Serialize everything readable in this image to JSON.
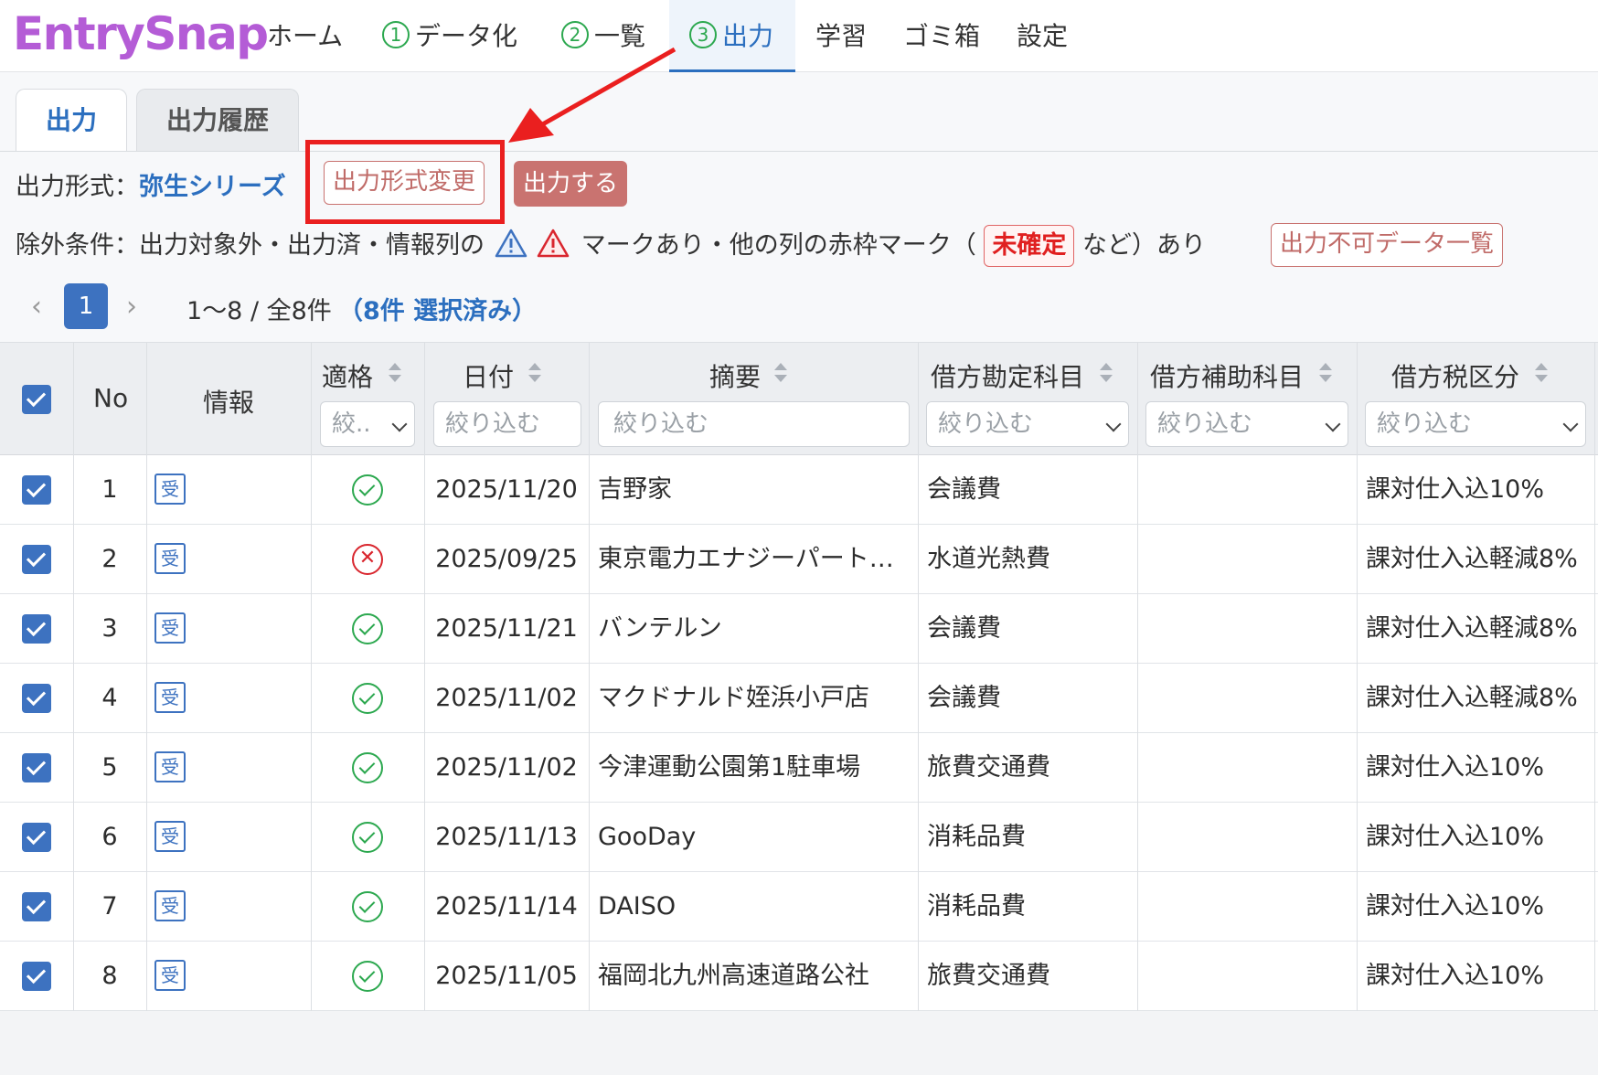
{
  "app": {
    "logo": "EntrySnap"
  },
  "nav": {
    "items": [
      {
        "label": "ホーム",
        "num": ""
      },
      {
        "label": "データ化",
        "num": "1"
      },
      {
        "label": "一覧",
        "num": "2"
      },
      {
        "label": "出力",
        "num": "3"
      },
      {
        "label": "学習",
        "num": ""
      },
      {
        "label": "ゴミ箱",
        "num": ""
      },
      {
        "label": "設定",
        "num": ""
      }
    ],
    "active": "出力"
  },
  "tabs": [
    {
      "label": "出力"
    },
    {
      "label": "出力履歴"
    }
  ],
  "output": {
    "format_label": "出力形式：",
    "format_value": "弥生シリーズ",
    "change_button": "出力形式変更",
    "export_button": "出力する"
  },
  "exclusion": {
    "prefix": "除外条件：出力対象外・出力済・情報列の",
    "middle": "マークあり・他の列の赤枠マーク（",
    "badge": "未確定",
    "suffix": "など）あり",
    "list_button": "出力不可データ一覧"
  },
  "pagination": {
    "prev": "‹",
    "current": "1",
    "next": "›",
    "range": "1〜8 / 全8件",
    "selected": "（8件 選択済み）"
  },
  "table": {
    "headers": {
      "no": "No",
      "info": "情報",
      "qualified": "適格",
      "date": "日付",
      "summary": "摘要",
      "debit_account": "借方勘定科目",
      "debit_sub": "借方補助科目",
      "debit_tax": "借方税区分"
    },
    "filters": {
      "qualified": "絞..",
      "date": "絞り込む",
      "summary": "絞り込む",
      "debit_account": "絞り込む",
      "debit_sub": "絞り込む",
      "debit_tax": "絞り込む"
    },
    "info_icon_char": "受",
    "rows": [
      {
        "no": "1",
        "qualified": "ok",
        "date": "2025/11/20",
        "summary": "吉野家",
        "account": "会議費",
        "sub": "",
        "tax": "課対仕入込10%"
      },
      {
        "no": "2",
        "qualified": "ng",
        "date": "2025/09/25",
        "summary": "東京電力エナジーパート…",
        "account": "水道光熱費",
        "sub": "",
        "tax": "課対仕入込軽減8%"
      },
      {
        "no": "3",
        "qualified": "ok",
        "date": "2025/11/21",
        "summary": "バンテルン",
        "account": "会議費",
        "sub": "",
        "tax": "課対仕入込軽減8%"
      },
      {
        "no": "4",
        "qualified": "ok",
        "date": "2025/11/02",
        "summary": "マクドナルド姪浜小戸店",
        "account": "会議費",
        "sub": "",
        "tax": "課対仕入込軽減8%"
      },
      {
        "no": "5",
        "qualified": "ok",
        "date": "2025/11/02",
        "summary": "今津運動公園第1駐車場",
        "account": "旅費交通費",
        "sub": "",
        "tax": "課対仕入込10%"
      },
      {
        "no": "6",
        "qualified": "ok",
        "date": "2025/11/13",
        "summary": "GooDay",
        "account": "消耗品費",
        "sub": "",
        "tax": "課対仕入込10%"
      },
      {
        "no": "7",
        "qualified": "ok",
        "date": "2025/11/14",
        "summary": "DAISO",
        "account": "消耗品費",
        "sub": "",
        "tax": "課対仕入込10%"
      },
      {
        "no": "8",
        "qualified": "ok",
        "date": "2025/11/05",
        "summary": "福岡北九州高速道路公社",
        "account": "旅費交通費",
        "sub": "",
        "tax": "課対仕入込10%"
      }
    ]
  },
  "colors": {
    "accent": "#2c6fbf",
    "button": "#c97370",
    "ok": "#2ca84f",
    "ng": "#d9262e",
    "annotation": "#ea1f1f"
  }
}
